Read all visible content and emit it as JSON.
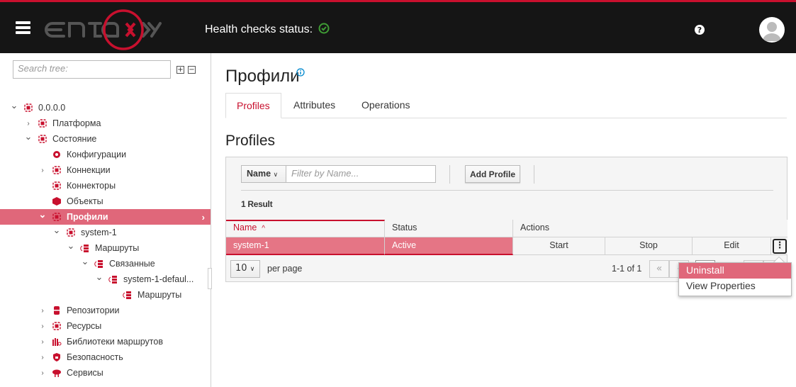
{
  "header": {
    "logo_text": "ENTAXY",
    "health_label": "Health checks status:",
    "health_status": "ok",
    "accent": "#c8102e"
  },
  "sidebar": {
    "search_placeholder": "Search tree:",
    "expand_all": "⊞",
    "collapse_all": "⊟",
    "items": [
      {
        "label": "0.0.0.0",
        "level": 0,
        "state": "expanded",
        "icon": "network-icon"
      },
      {
        "label": "Платформа",
        "level": 1,
        "state": "collapsed",
        "icon": "platform-icon"
      },
      {
        "label": "Состояние",
        "level": 1,
        "state": "expanded",
        "icon": "state-icon"
      },
      {
        "label": "Конфигурации",
        "level": 2,
        "state": "leaf",
        "icon": "gear-icon"
      },
      {
        "label": "Коннекции",
        "level": 2,
        "state": "collapsed",
        "icon": "connections-icon"
      },
      {
        "label": "Коннекторы",
        "level": 2,
        "state": "leaf",
        "icon": "connectors-icon"
      },
      {
        "label": "Объекты",
        "level": 2,
        "state": "leaf",
        "icon": "cube-icon"
      },
      {
        "label": "Профили",
        "level": 2,
        "state": "expanded",
        "icon": "profile-icon",
        "selected": true
      },
      {
        "label": "system-1",
        "level": 3,
        "state": "expanded",
        "icon": "profile-icon"
      },
      {
        "label": "Маршруты",
        "level": 4,
        "state": "expanded",
        "icon": "routes-icon"
      },
      {
        "label": "Связанные",
        "level": 5,
        "state": "expanded",
        "icon": "routes-icon"
      },
      {
        "label": "system-1-defaul...",
        "level": 6,
        "state": "expanded",
        "icon": "routes-icon"
      },
      {
        "label": "Маршруты",
        "level": 7,
        "state": "leaf",
        "icon": "routes-icon"
      },
      {
        "label": "Репозитории",
        "level": 2,
        "state": "collapsed",
        "icon": "database-icon"
      },
      {
        "label": "Ресурсы",
        "level": 2,
        "state": "collapsed",
        "icon": "resources-icon"
      },
      {
        "label": "Библиотеки маршрутов",
        "level": 2,
        "state": "collapsed",
        "icon": "library-icon"
      },
      {
        "label": "Безопасность",
        "level": 2,
        "state": "collapsed",
        "icon": "shield-icon"
      },
      {
        "label": "Сервисы",
        "level": 2,
        "state": "collapsed",
        "icon": "cloud-icon"
      }
    ]
  },
  "main": {
    "title": "Профили",
    "tabs": [
      {
        "label": "Profiles",
        "active": true
      },
      {
        "label": "Attributes"
      },
      {
        "label": "Operations"
      }
    ],
    "section_title": "Profiles",
    "filter": {
      "field": "Name",
      "placeholder": "Filter by Name..."
    },
    "add_button": "Add Profile",
    "result_count": "1 Result",
    "table": {
      "columns": [
        "Name",
        "Status",
        "Actions"
      ],
      "sort_indicator": "^",
      "rows": [
        {
          "name": "system-1",
          "status": "Active",
          "actions": [
            "Start",
            "Stop",
            "Edit"
          ]
        }
      ]
    },
    "pagination": {
      "per_page": "10",
      "per_page_label": "per page",
      "range": "1-1 of 1"
    },
    "kebab_menu": {
      "items": [
        "Uninstall",
        "View Properties"
      ]
    }
  }
}
